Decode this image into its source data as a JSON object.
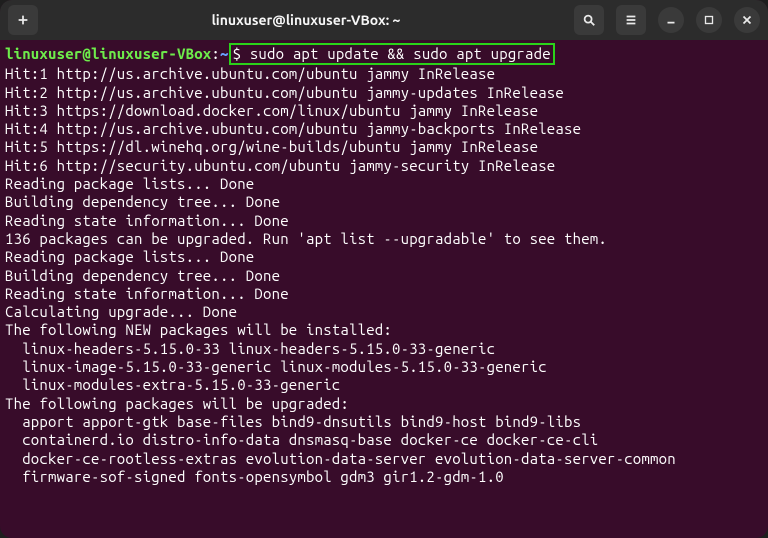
{
  "titlebar": {
    "title": "linuxuser@linuxuser-VBox: ~"
  },
  "prompt": {
    "userhost": "linuxuser@linuxuser-VBox",
    "sep": ":",
    "path": "~",
    "dollar": "$ ",
    "command": "sudo apt update && sudo apt upgrade"
  },
  "output": [
    "Hit:1 http://us.archive.ubuntu.com/ubuntu jammy InRelease",
    "Hit:2 http://us.archive.ubuntu.com/ubuntu jammy-updates InRelease",
    "Hit:3 https://download.docker.com/linux/ubuntu jammy InRelease",
    "Hit:4 http://us.archive.ubuntu.com/ubuntu jammy-backports InRelease",
    "Hit:5 https://dl.winehq.org/wine-builds/ubuntu jammy InRelease",
    "Hit:6 http://security.ubuntu.com/ubuntu jammy-security InRelease",
    "Reading package lists... Done",
    "Building dependency tree... Done",
    "Reading state information... Done",
    "136 packages can be upgraded. Run 'apt list --upgradable' to see them.",
    "Reading package lists... Done",
    "Building dependency tree... Done",
    "Reading state information... Done",
    "Calculating upgrade... Done",
    "The following NEW packages will be installed:",
    "  linux-headers-5.15.0-33 linux-headers-5.15.0-33-generic",
    "  linux-image-5.15.0-33-generic linux-modules-5.15.0-33-generic",
    "  linux-modules-extra-5.15.0-33-generic",
    "The following packages will be upgraded:",
    "  apport apport-gtk base-files bind9-dnsutils bind9-host bind9-libs",
    "  containerd.io distro-info-data dnsmasq-base docker-ce docker-ce-cli",
    "  docker-ce-rootless-extras evolution-data-server evolution-data-server-common",
    "  firmware-sof-signed fonts-opensymbol gdm3 gir1.2-gdm-1.0"
  ]
}
